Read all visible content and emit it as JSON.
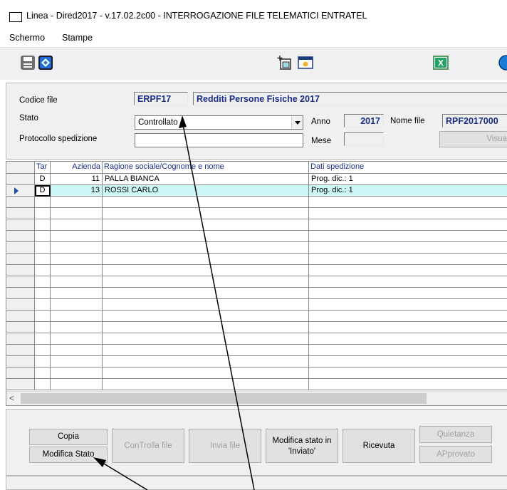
{
  "window": {
    "title": "Linea - Dired2017 - v.17.02.2c00 - INTERROGAZIONE FILE TELEMATICI ENTRATEL"
  },
  "menu": [
    {
      "label": "Schermo"
    },
    {
      "label": "Stampe"
    }
  ],
  "toolbar": {
    "icons": [
      "save-icon",
      "exit-icon",
      "new-document-icon",
      "window-icon",
      "excel-icon",
      "globe-icon"
    ],
    "excel_glyph": "X"
  },
  "header": {
    "codice_file_label": "Codice file",
    "codice_file_value": "ERPF17",
    "codice_file_desc": "Redditi Persone Fisiche 2017",
    "stato_label": "Stato",
    "stato_value": "Controllato",
    "anno_label": "Anno",
    "anno_value": "2017",
    "nome_file_label": "Nome file",
    "nome_file_value": "RPF2017000",
    "protocollo_label": "Protocollo spedizione",
    "protocollo_value": "",
    "mese_label": "Mese",
    "mese_value": "",
    "visualizza_label": "Visuali"
  },
  "grid": {
    "columns": [
      "Tar",
      "Azienda",
      "Ragione sociale/Cognome e nome",
      "Dati spedizione"
    ],
    "rows": [
      {
        "tar": "D",
        "azienda": "11",
        "ragione": "PALLA BIANCA",
        "dati": "Prog. dic.: 1",
        "selected": false
      },
      {
        "tar": "D",
        "azienda": "13",
        "ragione": "ROSSI CARLO",
        "dati": "Prog. dic.: 1",
        "selected": true
      }
    ],
    "empty_rows": 17,
    "row_indicator_icon": "row-pointer-icon",
    "scroll_left_glyph": "<",
    "selected_color": "#ccf7f7"
  },
  "buttons": {
    "copia": "Copia",
    "modifica_stato": "Modifica Stato",
    "controlla_file": "ConTrolla file",
    "invia_file": "Invia file",
    "modifica_inviato_line1": "Modifica stato in",
    "modifica_inviato_line2": "'Inviato'",
    "ricevuta": "Ricevuta",
    "quietanza": "Quietanza",
    "approvato": "APprovato"
  },
  "colors": {
    "accent_text": "#1a2f8a",
    "panel_bg": "#f0f0f0",
    "selection_bg": "#ccf7f7"
  }
}
